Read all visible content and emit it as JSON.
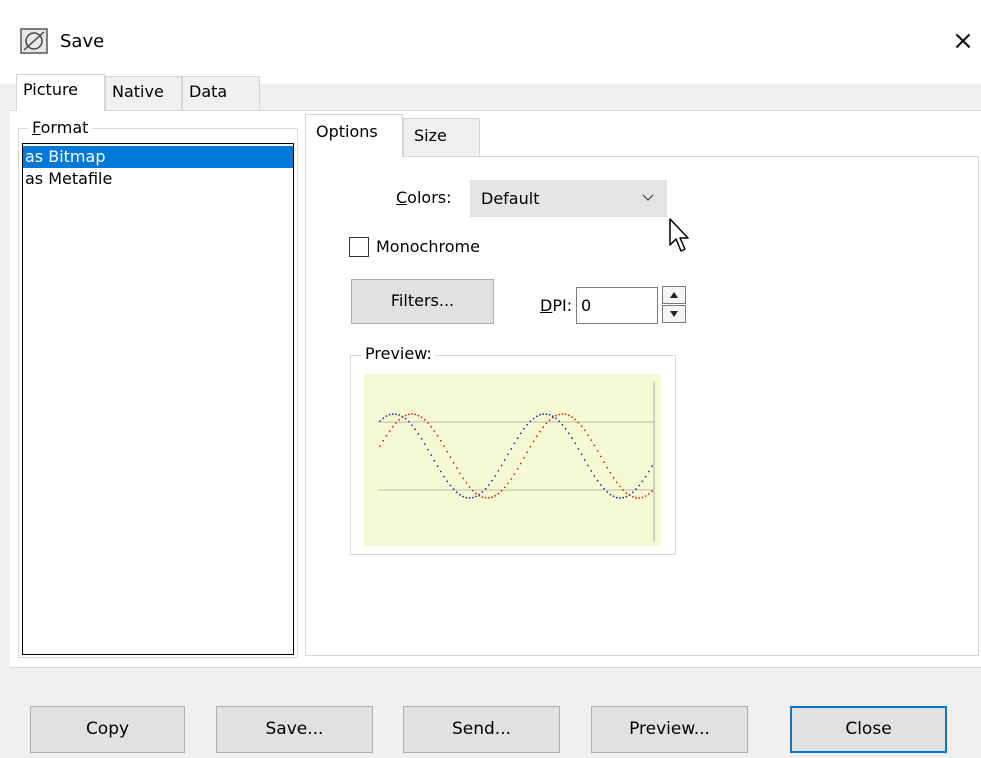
{
  "window": {
    "title": "Save",
    "close_glyph": "×"
  },
  "outer_tabs": [
    {
      "label": "Picture",
      "active": true
    },
    {
      "label": "Native",
      "active": false
    },
    {
      "label": "Data",
      "active": false
    }
  ],
  "format": {
    "legend_first": "F",
    "legend_rest": "ormat",
    "items": [
      {
        "label": "as Bitmap",
        "selected": true
      },
      {
        "label": "as Metafile",
        "selected": false
      }
    ]
  },
  "inner_tabs": [
    {
      "label": "Options",
      "active": true
    },
    {
      "label": "Size",
      "active": false
    }
  ],
  "options": {
    "colors_label_first": "C",
    "colors_label_rest": "olors:",
    "colors_value": "Default",
    "monochrome_label": "Monochrome",
    "monochrome_checked": false,
    "filters_label": "Filters...",
    "dpi_label_first": "D",
    "dpi_label_rest": "PI:",
    "dpi_value": "0",
    "preview_legend": "Preview:"
  },
  "preview_thumbnail": {
    "background": "#f5fad2",
    "series_colors": [
      "#1a3aa6",
      "#cc2a1a"
    ]
  },
  "buttons": {
    "copy": "Copy",
    "save": "Save...",
    "send": "Send...",
    "preview": "Preview...",
    "close": "Close"
  },
  "colors": {
    "selection": "#0078d7",
    "default_button_border": "#0078d7"
  }
}
